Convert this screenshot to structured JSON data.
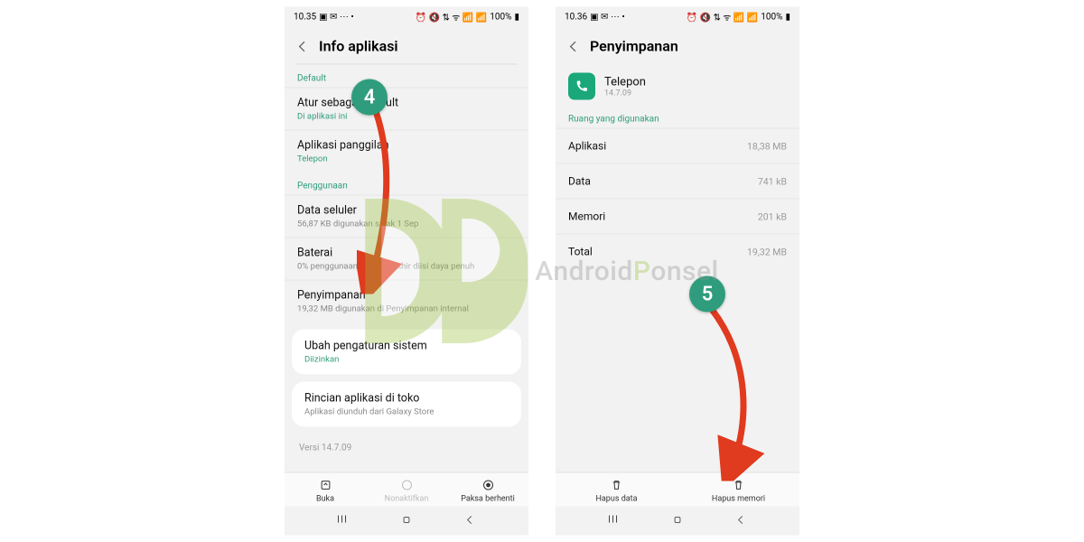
{
  "watermark": {
    "prefix": "Android",
    "highlight": "P",
    "suffix": "onsel"
  },
  "steps": {
    "s4": "4",
    "s5": "5"
  },
  "left": {
    "status": {
      "time": "10.35",
      "battery": "100%"
    },
    "header": {
      "title": "Info aplikasi"
    },
    "section_default_label": "Default",
    "rows_default": [
      {
        "title": "Atur sebagai default",
        "sub": "Di aplikasi ini",
        "sub_green": true
      },
      {
        "title": "Aplikasi panggilan",
        "sub": "Telepon",
        "sub_green": true
      }
    ],
    "section_usage_label": "Penggunaan",
    "rows_usage": [
      {
        "title": "Data seluler",
        "sub": "56,87 KB digunakan sejak 1 Sep"
      },
      {
        "title": "Baterai",
        "sub": "0% penggunaan sejak terakhir diisi daya penuh"
      },
      {
        "title": "Penyimpanan",
        "sub": "19,32 MB digunakan di Penyimpanan internal"
      }
    ],
    "card1": {
      "title": "Ubah pengaturan sistem",
      "sub": "Diizinkan",
      "sub_green": true
    },
    "card2": {
      "title": "Rincian aplikasi di toko",
      "sub": "Aplikasi diunduh dari Galaxy Store"
    },
    "version": "Versi 14.7.09",
    "actions": {
      "open": "Buka",
      "disable": "Nonaktifkan",
      "force": "Paksa berhenti"
    }
  },
  "right": {
    "status": {
      "time": "10.36",
      "battery": "100%"
    },
    "header": {
      "title": "Penyimpanan"
    },
    "app": {
      "name": "Telepon",
      "version": "14.7.09"
    },
    "section_label": "Ruang yang digunakan",
    "kv": [
      {
        "k": "Aplikasi",
        "v": "18,38 MB"
      },
      {
        "k": "Data",
        "v": "741 kB"
      },
      {
        "k": "Memori",
        "v": "201 kB"
      },
      {
        "k": "Total",
        "v": "19,32 MB"
      }
    ],
    "actions": {
      "clear_data": "Hapus data",
      "clear_cache": "Hapus memori"
    }
  }
}
